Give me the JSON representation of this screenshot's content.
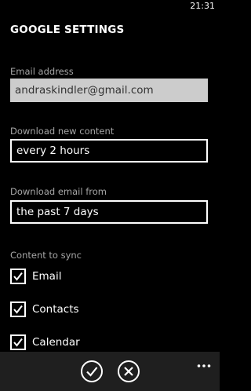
{
  "status_bar": {
    "time": "21:31"
  },
  "page": {
    "title": "GOOGLE SETTINGS"
  },
  "fields": {
    "email": {
      "label": "Email address",
      "value": "andraskindler@gmail.com"
    },
    "download_content": {
      "label": "Download new content",
      "value": "every 2 hours"
    },
    "download_from": {
      "label": "Download email from",
      "value": "the past 7 days"
    }
  },
  "sync": {
    "label": "Content to sync",
    "items": [
      {
        "label": "Email",
        "checked": true
      },
      {
        "label": "Contacts",
        "checked": true
      },
      {
        "label": "Calendar",
        "checked": true
      }
    ]
  },
  "app_bar": {
    "buttons": [
      {
        "icon": "check-icon"
      },
      {
        "icon": "close-icon"
      }
    ],
    "more": "more-icon"
  },
  "colors": {
    "background": "#000000",
    "foreground": "#ffffff",
    "label": "#a6a6a6",
    "disabled_field": "#cccccc",
    "app_bar": "#1f1f1f"
  }
}
